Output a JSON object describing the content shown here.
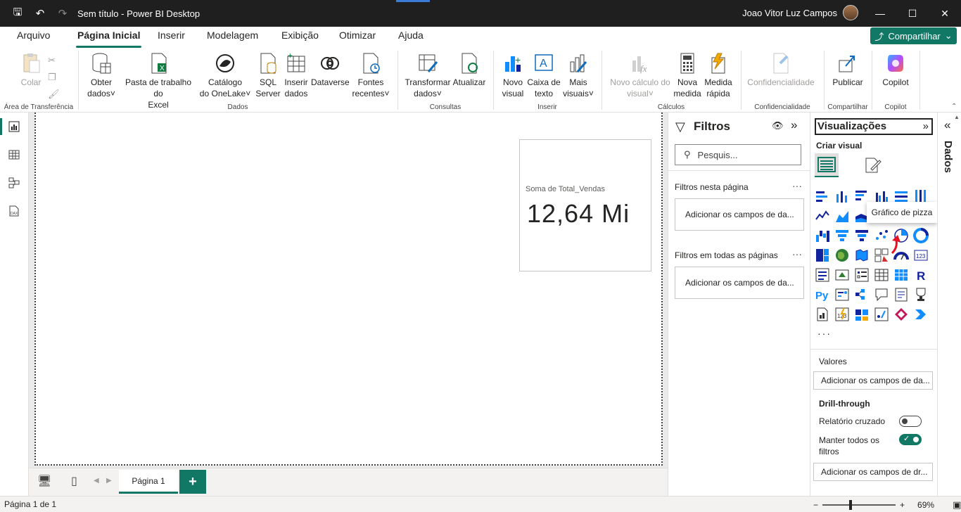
{
  "titlebar": {
    "title": "Sem título - Power BI Desktop",
    "user": "Joao Vitor Luz Campos"
  },
  "menu": {
    "tabs": [
      "Arquivo",
      "Página Inicial",
      "Inserir",
      "Modelagem",
      "Exibição",
      "Otimizar",
      "Ajuda"
    ],
    "active": "Página Inicial",
    "share_label": "Compartilhar"
  },
  "ribbon": {
    "colar": "Colar",
    "obter_dados_1": "Obter",
    "obter_dados_2": "dados",
    "pasta_1": "Pasta de trabalho do",
    "pasta_2": "Excel",
    "catalogo_1": "Catálogo",
    "catalogo_2": "do OneLake",
    "sql_1": "SQL",
    "sql_2": "Server",
    "inserir_dados_1": "Inserir",
    "inserir_dados_2": "dados",
    "dataverse": "Dataverse",
    "fontes_1": "Fontes",
    "fontes_2": "recentes",
    "transformar_1": "Transformar",
    "transformar_2": "dados",
    "atualizar": "Atualizar",
    "novo_visual_1": "Novo",
    "novo_visual_2": "visual",
    "caixa_texto_1": "Caixa de",
    "caixa_texto_2": "texto",
    "mais_visuais_1": "Mais",
    "mais_visuais_2": "visuais",
    "novo_calculo_1": "Novo cálculo do",
    "novo_calculo_2": "visual",
    "nova_medida_1": "Nova",
    "nova_medida_2": "medida",
    "medida_rapida_1": "Medida",
    "medida_rapida_2": "rápida",
    "confidencialidade": "Confidencialidade",
    "publicar": "Publicar",
    "copilot": "Copilot",
    "groups": {
      "transferencia": "Área de Transferência",
      "dados": "Dados",
      "consultas": "Consultas",
      "inserir": "Inserir",
      "calculos": "Cálculos",
      "confidencialidade": "Confidencialidade",
      "compartilhar": "Compartilhar",
      "copilot": "Copilot"
    }
  },
  "card": {
    "label": "Soma de Total_Vendas",
    "value": "12,64 Mi"
  },
  "pages": {
    "tab": "Página 1",
    "add": "+"
  },
  "status": {
    "page": "Página 1 de 1",
    "zoom": "69%",
    "zoom_minus": "−",
    "zoom_plus": "+"
  },
  "filters": {
    "title": "Filtros",
    "search_placeholder": "Pesquis...",
    "this_page": "Filtros nesta página",
    "all_pages": "Filtros em todas as páginas",
    "add_fields_1": "Adicionar os campos de da...",
    "add_fields_2": "Adicionar os campos de da...",
    "more": "···"
  },
  "viz": {
    "title": "Visualizações",
    "build": "Criar visual",
    "tooltip": "Gráfico de pizza",
    "more": "···",
    "values_label": "Valores",
    "values_well": "Adicionar os campos de da...",
    "drill_label": "Drill-through",
    "cross_report": "Relatório cruzado",
    "keep_filters_1": "Manter todos os",
    "keep_filters_2": "filtros",
    "drill_well": "Adicionar os campos de dr...",
    "cross_report_on": false,
    "keep_filters_on": true
  },
  "data_pane": {
    "label": "Dados"
  },
  "colors": {
    "accent": "#117865",
    "titlebar": "#1f1f1f",
    "chart_blue": "#118dff",
    "chart_dark": "#12239e"
  }
}
